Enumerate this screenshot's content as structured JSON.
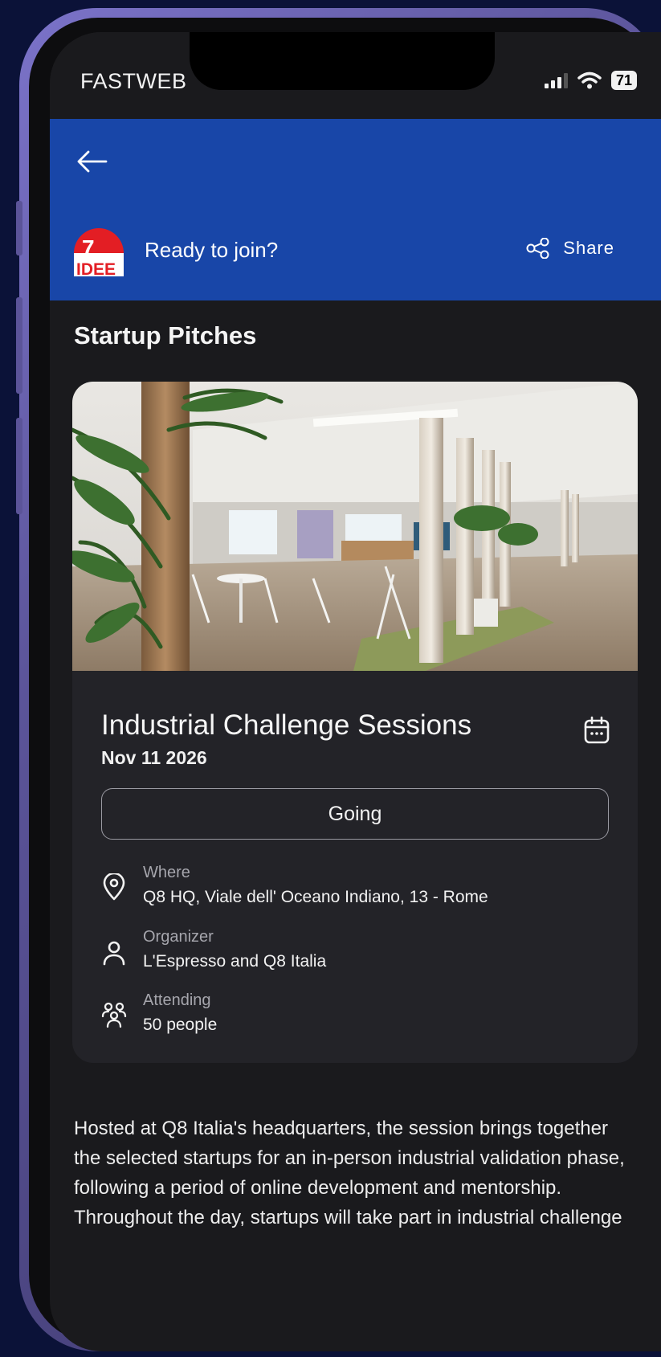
{
  "status_bar": {
    "carrier": "FASTWEB",
    "battery": "71"
  },
  "header": {
    "title": "Ready to join?",
    "share_label": "Share",
    "logo_text_top": "7",
    "logo_text_bottom": "IDEE"
  },
  "section_title": "Startup Pitches",
  "event": {
    "title": "Industrial Challenge Sessions",
    "date": "Nov 11 2026",
    "going_label": "Going",
    "where_label": "Where",
    "where_value": "Q8 HQ, Viale dell' Oceano Indiano, 13 - Rome",
    "organizer_label": "Organizer",
    "organizer_value": "L'Espresso and Q8 Italia",
    "attending_label": "Attending",
    "attending_value": "50 people"
  },
  "description": "Hosted at Q8 Italia's headquarters, the session brings together the selected startups for an in-person industrial validation phase, following a period of online development and mentorship. Throughout the day, startups will take part in industrial challenge",
  "colors": {
    "header_bg": "#1846a8",
    "screen_bg": "#1a1a1d",
    "card_bg": "#232328",
    "page_bg": "#0b1238",
    "frame": "#6d66b8"
  },
  "icons": [
    "back-arrow-icon",
    "share-icon",
    "calendar-icon",
    "location-pin-icon",
    "person-icon",
    "people-group-icon",
    "wifi-icon",
    "signal-icon",
    "battery-icon"
  ]
}
